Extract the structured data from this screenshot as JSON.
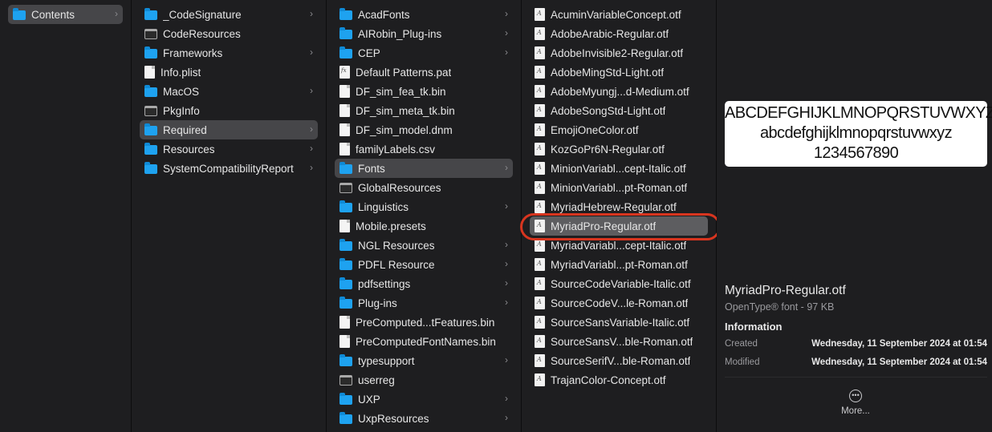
{
  "columns": [
    {
      "items": [
        {
          "label": "Contents",
          "icon": "folder",
          "chevron": true,
          "selected": "gray"
        }
      ]
    },
    {
      "items": [
        {
          "label": "_CodeSignature",
          "icon": "folder",
          "chevron": true
        },
        {
          "label": "CodeResources",
          "icon": "exec"
        },
        {
          "label": "Frameworks",
          "icon": "folder",
          "chevron": true
        },
        {
          "label": "Info.plist",
          "icon": "doc"
        },
        {
          "label": "MacOS",
          "icon": "folder",
          "chevron": true
        },
        {
          "label": "PkgInfo",
          "icon": "exec"
        },
        {
          "label": "Required",
          "icon": "folder",
          "chevron": true,
          "selected": "gray"
        },
        {
          "label": "Resources",
          "icon": "folder",
          "chevron": true
        },
        {
          "label": "SystemCompatibilityReport",
          "icon": "folder",
          "chevron": true
        }
      ]
    },
    {
      "items": [
        {
          "label": "AcadFonts",
          "icon": "folder",
          "chevron": true
        },
        {
          "label": "AIRobin_Plug-ins",
          "icon": "folder",
          "chevron": true
        },
        {
          "label": "CEP",
          "icon": "folder",
          "chevron": true
        },
        {
          "label": "Default Patterns.pat",
          "icon": "pat"
        },
        {
          "label": "DF_sim_fea_tk.bin",
          "icon": "doc"
        },
        {
          "label": "DF_sim_meta_tk.bin",
          "icon": "doc"
        },
        {
          "label": "DF_sim_model.dnm",
          "icon": "doc"
        },
        {
          "label": "familyLabels.csv",
          "icon": "doc"
        },
        {
          "label": "Fonts",
          "icon": "folder",
          "chevron": true,
          "selected": "gray"
        },
        {
          "label": "GlobalResources",
          "icon": "exec"
        },
        {
          "label": "Linguistics",
          "icon": "folder",
          "chevron": true
        },
        {
          "label": "Mobile.presets",
          "icon": "doc"
        },
        {
          "label": "NGL Resources",
          "icon": "folder",
          "chevron": true
        },
        {
          "label": "PDFL Resource",
          "icon": "folder",
          "chevron": true
        },
        {
          "label": "pdfsettings",
          "icon": "folder",
          "chevron": true
        },
        {
          "label": "Plug-ins",
          "icon": "folder",
          "chevron": true
        },
        {
          "label": "PreComputed...tFeatures.bin",
          "icon": "doc"
        },
        {
          "label": "PreComputedFontNames.bin",
          "icon": "doc"
        },
        {
          "label": "typesupport",
          "icon": "folder",
          "chevron": true
        },
        {
          "label": "userreg",
          "icon": "exec"
        },
        {
          "label": "UXP",
          "icon": "folder",
          "chevron": true
        },
        {
          "label": "UxpResources",
          "icon": "folder",
          "chevron": true
        }
      ]
    },
    {
      "items": [
        {
          "label": "AcuminVariableConcept.otf",
          "icon": "font"
        },
        {
          "label": "AdobeArabic-Regular.otf",
          "icon": "font"
        },
        {
          "label": "AdobeInvisible2-Regular.otf",
          "icon": "font"
        },
        {
          "label": "AdobeMingStd-Light.otf",
          "icon": "font"
        },
        {
          "label": "AdobeMyungj...d-Medium.otf",
          "icon": "font"
        },
        {
          "label": "AdobeSongStd-Light.otf",
          "icon": "font"
        },
        {
          "label": "EmojiOneColor.otf",
          "icon": "font"
        },
        {
          "label": "KozGoPr6N-Regular.otf",
          "icon": "font"
        },
        {
          "label": "MinionVariabl...cept-Italic.otf",
          "icon": "font"
        },
        {
          "label": "MinionVariabl...pt-Roman.otf",
          "icon": "font"
        },
        {
          "label": "MyriadHebrew-Regular.otf",
          "icon": "font"
        },
        {
          "label": "MyriadPro-Regular.otf",
          "icon": "font",
          "selected": "focus"
        },
        {
          "label": "MyriadVariabl...cept-Italic.otf",
          "icon": "font"
        },
        {
          "label": "MyriadVariabl...pt-Roman.otf",
          "icon": "font"
        },
        {
          "label": "SourceCodeVariable-Italic.otf",
          "icon": "font"
        },
        {
          "label": "SourceCodeV...le-Roman.otf",
          "icon": "font"
        },
        {
          "label": "SourceSansVariable-Italic.otf",
          "icon": "font"
        },
        {
          "label": "SourceSansV...ble-Roman.otf",
          "icon": "font"
        },
        {
          "label": "SourceSerifV...ble-Roman.otf",
          "icon": "font"
        },
        {
          "label": "TrajanColor-Concept.otf",
          "icon": "font"
        }
      ]
    }
  ],
  "preview": {
    "sample_upper": "ABCDEFGHIJKLMNOPQRSTUVWXYZ",
    "sample_lower": "abcdefghijklmnopqrstuvwxyz",
    "sample_digits": "1234567890",
    "file_name": "MyriadPro-Regular.otf",
    "file_kind": "OpenType® font - 97 KB",
    "info_heading": "Information",
    "created_label": "Created",
    "created_value": "Wednesday, 11 September 2024 at 01:54",
    "modified_label": "Modified",
    "modified_value": "Wednesday, 11 September 2024 at 01:54",
    "more_label": "More...",
    "more_icon": "ellipsis-circle-icon"
  },
  "colors": {
    "folder": "#1ea2f0",
    "selection_gray": "#464649",
    "selection_focus": "#5d5d60",
    "annotation_ring": "#d8351f"
  }
}
